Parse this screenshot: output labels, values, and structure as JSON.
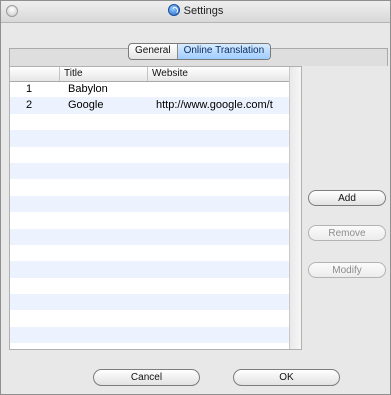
{
  "window": {
    "title": "Settings"
  },
  "tabs": [
    {
      "label": "General",
      "selected": false
    },
    {
      "label": "Online Translation",
      "selected": true
    }
  ],
  "table": {
    "columns": [
      "",
      "Title",
      "Website"
    ],
    "rows": [
      {
        "index": "1",
        "title": "Babylon",
        "website": ""
      },
      {
        "index": "2",
        "title": "Google",
        "website": "http://www.google.com/t"
      }
    ]
  },
  "buttons": {
    "add": "Add",
    "remove": "Remove",
    "modify": "Modify",
    "cancel": "Cancel",
    "ok": "OK"
  },
  "colors": {
    "selected_tab": "#9fcdff",
    "stripe": "#edf3fe"
  }
}
